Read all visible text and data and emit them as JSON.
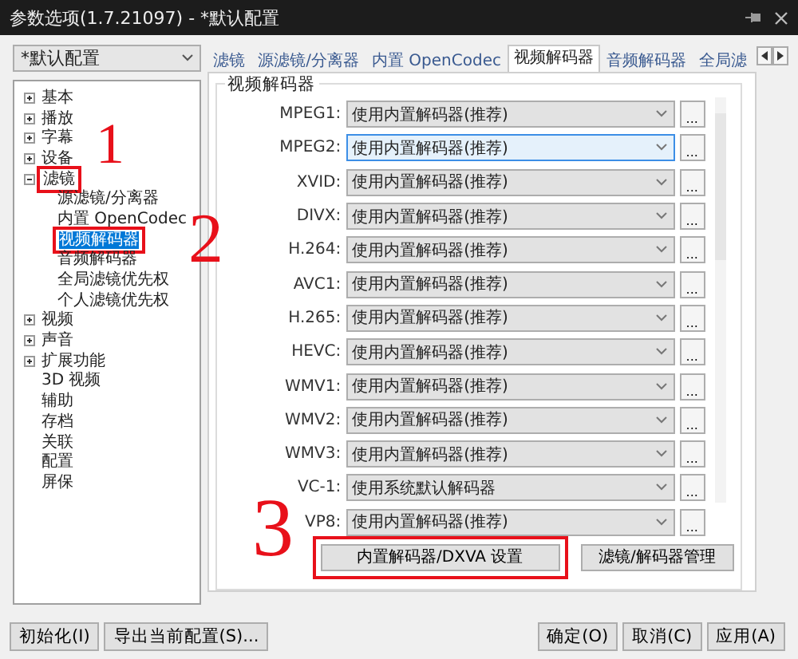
{
  "window": {
    "title": "参数选项(1.7.21097) - *默认配置"
  },
  "profile_select": {
    "value": "*默认配置"
  },
  "tree": {
    "items": [
      {
        "label": "基本",
        "expanded": false,
        "selected": false
      },
      {
        "label": "播放",
        "expanded": false,
        "selected": false
      },
      {
        "label": "字幕",
        "expanded": false,
        "selected": false
      },
      {
        "label": "设备",
        "expanded": false,
        "selected": false
      },
      {
        "label": "滤镜",
        "expanded": true,
        "selected": false,
        "highlighted": true,
        "children": [
          {
            "label": "源滤镜/分离器",
            "selected": false
          },
          {
            "label": "内置 OpenCodec",
            "selected": false
          },
          {
            "label": "视频解码器",
            "selected": true,
            "highlighted": true
          },
          {
            "label": "音频解码器",
            "selected": false
          },
          {
            "label": "全局滤镜优先权",
            "selected": false
          },
          {
            "label": "个人滤镜优先权",
            "selected": false
          }
        ]
      },
      {
        "label": "视频",
        "expanded": false,
        "selected": false
      },
      {
        "label": "声音",
        "expanded": false,
        "selected": false
      },
      {
        "label": "扩展功能",
        "expanded": false,
        "selected": false
      },
      {
        "label": "3D 视频",
        "selected": false
      },
      {
        "label": "辅助",
        "selected": false
      },
      {
        "label": "存档",
        "selected": false
      },
      {
        "label": "关联",
        "selected": false
      },
      {
        "label": "配置",
        "selected": false
      },
      {
        "label": "屏保",
        "selected": false
      }
    ]
  },
  "tabs": [
    {
      "label": "滤镜",
      "selected": false
    },
    {
      "label": "源滤镜/分离器",
      "selected": false
    },
    {
      "label": "内置 OpenCodec",
      "selected": false
    },
    {
      "label": "视频解码器",
      "selected": true
    },
    {
      "label": "音频解码器",
      "selected": false
    },
    {
      "label": "全局滤",
      "selected": false
    }
  ],
  "group": {
    "title": "视频解码器",
    "rows": [
      {
        "label": "MPEG1:",
        "value": "使用内置解码器(推荐)",
        "focused": false,
        "more": "..."
      },
      {
        "label": "MPEG2:",
        "value": "使用内置解码器(推荐)",
        "focused": true,
        "more": "..."
      },
      {
        "label": "XVID:",
        "value": "使用内置解码器(推荐)",
        "focused": false,
        "more": "..."
      },
      {
        "label": "DIVX:",
        "value": "使用内置解码器(推荐)",
        "focused": false,
        "more": "..."
      },
      {
        "label": "H.264:",
        "value": "使用内置解码器(推荐)",
        "focused": false,
        "more": "..."
      },
      {
        "label": "AVC1:",
        "value": "使用内置解码器(推荐)",
        "focused": false,
        "more": "..."
      },
      {
        "label": "H.265:",
        "value": "使用内置解码器(推荐)",
        "focused": false,
        "more": "..."
      },
      {
        "label": "HEVC:",
        "value": "使用内置解码器(推荐)",
        "focused": false,
        "more": "..."
      },
      {
        "label": "WMV1:",
        "value": "使用内置解码器(推荐)",
        "focused": false,
        "more": "..."
      },
      {
        "label": "WMV2:",
        "value": "使用内置解码器(推荐)",
        "focused": false,
        "more": "..."
      },
      {
        "label": "WMV3:",
        "value": "使用内置解码器(推荐)",
        "focused": false,
        "more": "..."
      },
      {
        "label": "VC-1:",
        "value": "使用系统默认解码器",
        "focused": false,
        "more": "..."
      },
      {
        "label": "VP8:",
        "value": "使用内置解码器(推荐)",
        "focused": false,
        "more": "..."
      }
    ],
    "buttons": [
      {
        "label": "内置解码器/DXVA 设置",
        "highlighted": true
      },
      {
        "label": "滤镜/解码器管理",
        "highlighted": false
      }
    ]
  },
  "footer": {
    "left_buttons": [
      "初始化(I)",
      "导出当前配置(S)..."
    ],
    "right_buttons": [
      "确定(O)",
      "取消(C)",
      "应用(A)"
    ]
  },
  "annotations": [
    {
      "label": "1"
    },
    {
      "label": "2"
    },
    {
      "label": "3"
    }
  ]
}
